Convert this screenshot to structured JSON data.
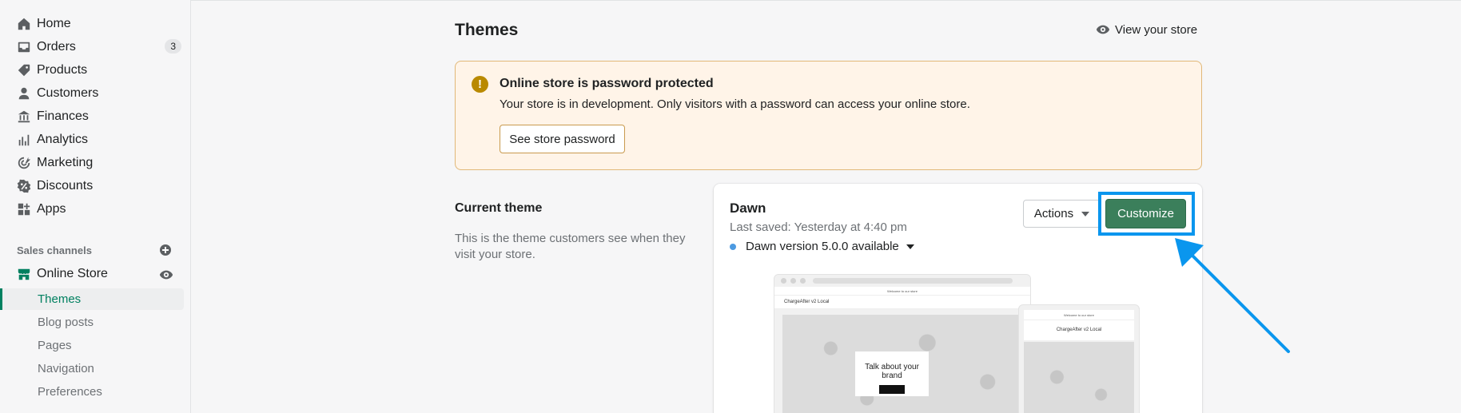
{
  "sidebar": {
    "items": [
      {
        "label": "Home",
        "icon": "home-icon"
      },
      {
        "label": "Orders",
        "icon": "orders-icon",
        "badge": "3"
      },
      {
        "label": "Products",
        "icon": "tag-icon"
      },
      {
        "label": "Customers",
        "icon": "person-icon"
      },
      {
        "label": "Finances",
        "icon": "bank-icon"
      },
      {
        "label": "Analytics",
        "icon": "bar-chart-icon"
      },
      {
        "label": "Marketing",
        "icon": "target-icon"
      },
      {
        "label": "Discounts",
        "icon": "discount-icon"
      },
      {
        "label": "Apps",
        "icon": "apps-icon"
      }
    ],
    "sales_channels_label": "Sales channels",
    "online_store_label": "Online Store",
    "sub_items": [
      "Themes",
      "Blog posts",
      "Pages",
      "Navigation",
      "Preferences"
    ]
  },
  "header": {
    "title": "Themes",
    "view_store": "View your store"
  },
  "banner": {
    "title": "Online store is password protected",
    "text": "Your store is in development. Only visitors with a password can access your online store.",
    "button": "See store password"
  },
  "current_theme": {
    "heading": "Current theme",
    "description": "This is the theme customers see when they visit your store.",
    "name": "Dawn",
    "last_saved": "Last saved: Yesterday at 4:40 pm",
    "version": "Dawn version 5.0.0 available",
    "actions_label": "Actions",
    "customize_label": "Customize"
  },
  "preview": {
    "announcement": "Welcome to our store",
    "store_name": "ChargeAfter v2 Local",
    "hero_text": "Talk about your brand",
    "mobile_announcement": "Welcome to our store",
    "mobile_store_name": "ChargeAfter v2 Local"
  },
  "colors": {
    "accent": "#008060",
    "customize_bg": "#3b7f5b",
    "highlight": "#0a96ee",
    "banner_bg": "#fff4e8",
    "warning": "#b98900"
  }
}
